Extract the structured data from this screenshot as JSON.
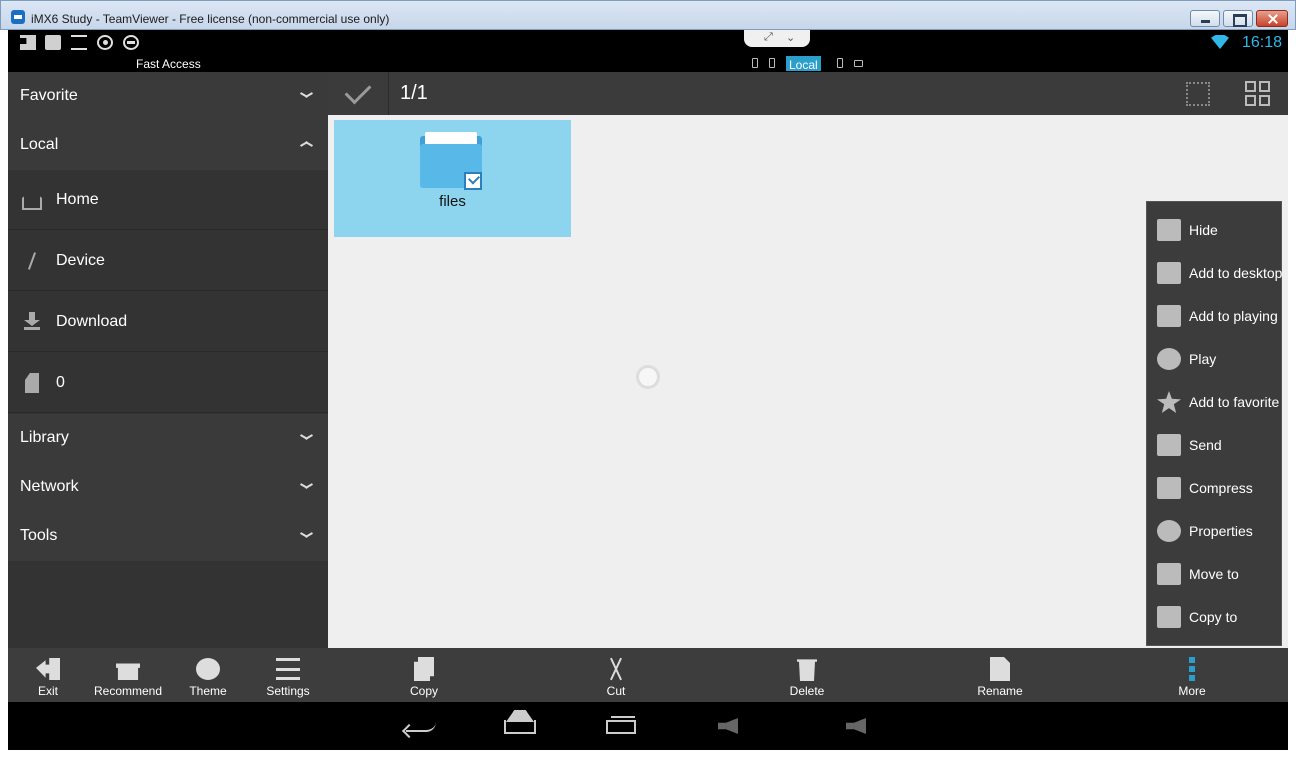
{
  "window": {
    "title": "iMX6 Study - TeamViewer - Free license (non-commercial use only)"
  },
  "statusbar": {
    "clock": "16:18",
    "accent_color": "#2fb8e8"
  },
  "breadcrumb": {
    "fast_access": "Fast Access",
    "current": "Local"
  },
  "sidebar": {
    "favorite": "Favorite",
    "local": "Local",
    "items": [
      {
        "label": "Home",
        "icon": "home-icon"
      },
      {
        "label": "Device",
        "icon": "slash-icon"
      },
      {
        "label": "Download",
        "icon": "download-icon"
      },
      {
        "label": "0",
        "icon": "sd-card-icon"
      }
    ],
    "library": "Library",
    "network": "Network",
    "tools": "Tools",
    "bottom": [
      {
        "label": "Exit",
        "icon": "exit-icon"
      },
      {
        "label": "Recommend",
        "icon": "gift-icon"
      },
      {
        "label": "Theme",
        "icon": "theme-icon"
      },
      {
        "label": "Settings",
        "icon": "settings-icon"
      }
    ]
  },
  "toolbar": {
    "selection_count": "1/1"
  },
  "files": [
    {
      "name": "files",
      "selected": true
    }
  ],
  "context_menu": [
    {
      "label": "Hide",
      "icon": "hide-folder-icon"
    },
    {
      "label": "Add to desktop",
      "icon": "add-to-desktop-icon"
    },
    {
      "label": "Add to playing",
      "icon": "add-to-playing-icon"
    },
    {
      "label": "Play",
      "icon": "play-icon"
    },
    {
      "label": "Add to favorite",
      "icon": "favorite-icon"
    },
    {
      "label": "Send",
      "icon": "send-icon"
    },
    {
      "label": "Compress",
      "icon": "compress-icon"
    },
    {
      "label": "Properties",
      "icon": "properties-icon"
    },
    {
      "label": "Move to",
      "icon": "move-to-icon"
    },
    {
      "label": "Copy to",
      "icon": "copy-to-icon"
    }
  ],
  "actions": [
    {
      "label": "Copy",
      "icon": "copy-icon"
    },
    {
      "label": "Cut",
      "icon": "cut-icon"
    },
    {
      "label": "Delete",
      "icon": "delete-icon"
    },
    {
      "label": "Rename",
      "icon": "rename-icon"
    },
    {
      "label": "More",
      "icon": "more-icon"
    }
  ]
}
